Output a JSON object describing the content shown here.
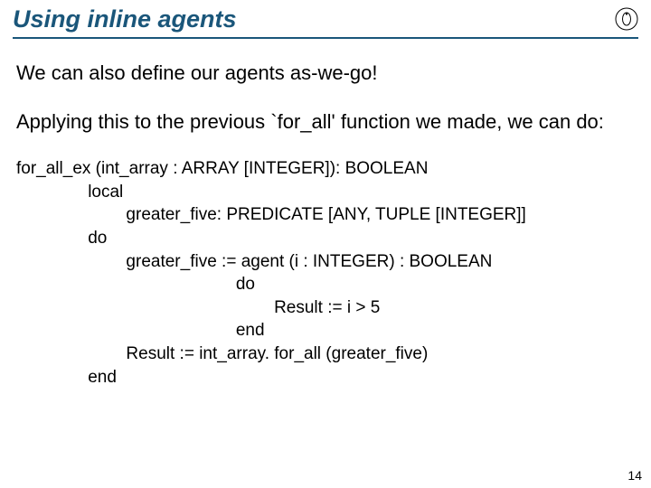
{
  "slide": {
    "title": "Using inline agents",
    "para1": "We can also define our agents as-we-go!",
    "para2_pre": "Applying this to the previous `",
    "para2_fn": "for_all",
    "para2_post": "' function we made, we can do:",
    "code": {
      "sig": "for_all_ex (int_array : ARRAY [INTEGER]): BOOLEAN",
      "local_kw": "local",
      "local_decl": "greater_five: PREDICATE [ANY, TUPLE [INTEGER]]",
      "do_kw": "do",
      "assign_agent": "greater_five := agent (i : INTEGER) : BOOLEAN",
      "inner_do": "do",
      "inner_body": "Result := i > 5",
      "inner_end": "end",
      "result_line": "Result := int_array. for_all (greater_five)",
      "end_kw": "end"
    },
    "page_number": "14"
  }
}
